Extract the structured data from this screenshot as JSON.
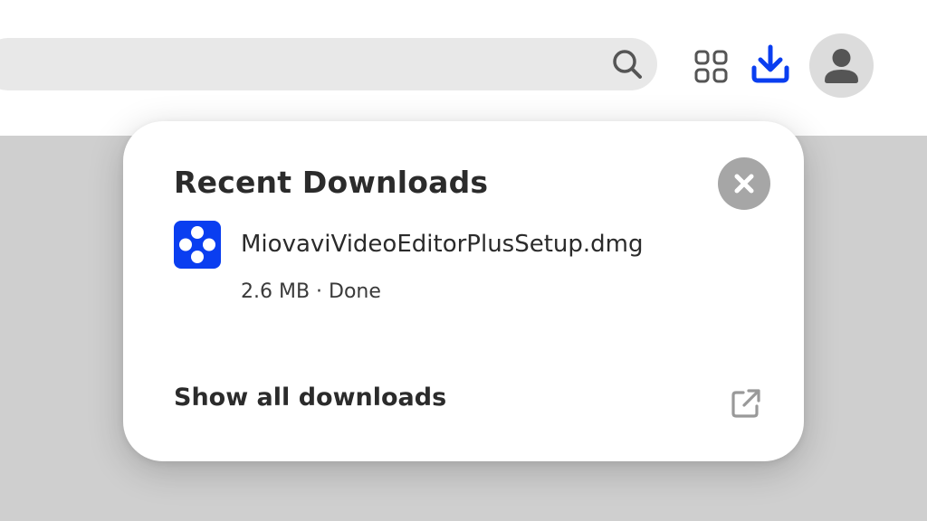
{
  "toolbar": {
    "search_icon": "search-icon",
    "apps_icon": "apps-grid-icon",
    "download_icon": "download-icon",
    "avatar_icon": "user-avatar-icon",
    "accent_color": "#0a3ef0"
  },
  "downloads_popup": {
    "title": "Recent Downloads",
    "close_icon": "close-icon",
    "items": [
      {
        "file_name": "MiovaviVideoEditorPlusSetup.dmg",
        "meta": "2.6 MB · Done",
        "icon": "app-file-icon",
        "icon_color": "#0a3ef0"
      }
    ],
    "show_all_label": "Show all downloads",
    "show_all_icon": "open-external-icon"
  }
}
